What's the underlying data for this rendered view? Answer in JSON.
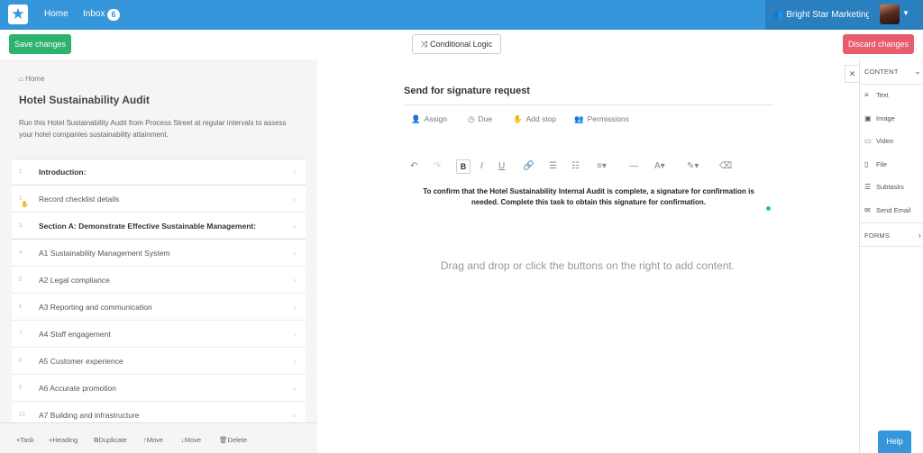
{
  "nav": {
    "home": "Home",
    "inbox": "Inbox",
    "inbox_count": "6",
    "org_name": "Bright Star Marketing"
  },
  "toolbar": {
    "save_label": "Save changes",
    "logic_label": "Conditional Logic",
    "discard_label": "Discard changes"
  },
  "checklist": {
    "breadcrumb": "Home",
    "title": "Hotel Sustainability Audit",
    "description": "Run this Hotel Sustainability Audit from Process Street at regular intervals to assess your hotel companies sustainability attainment.",
    "tasks": [
      {
        "num": "1",
        "label": "Introduction:",
        "heading": true
      },
      {
        "num": "2",
        "label": "Record checklist details",
        "heading": false
      },
      {
        "num": "3",
        "label": "Section A: Demonstrate Effective Sustainable Management:",
        "heading": true
      },
      {
        "num": "4",
        "label": "A1 Sustainability Management System",
        "heading": false
      },
      {
        "num": "5",
        "label": "A2 Legal compliance",
        "heading": false
      },
      {
        "num": "6",
        "label": "A3 Reporting and communication",
        "heading": false
      },
      {
        "num": "7",
        "label": "A4 Staff engagement",
        "heading": false
      },
      {
        "num": "8",
        "label": "A5 Customer experience",
        "heading": false
      },
      {
        "num": "9",
        "label": "A6 Accurate promotion",
        "heading": false
      },
      {
        "num": "10",
        "label": "A7 Building and infrastructure",
        "heading": false
      }
    ]
  },
  "bottom_actions": {
    "task": "Task",
    "heading": "Heading",
    "duplicate": "Duplicate",
    "move_up": "Move",
    "move_down": "Move",
    "delete": "Delete"
  },
  "editor": {
    "task_title": "Send for signature request",
    "assign": "Assign",
    "due": "Due",
    "add_stop": "Add stop",
    "permissions": "Permissions",
    "body": "To confirm that the Hotel Sustainability Internal Audit is complete, a signature for confirmation is needed. Complete this task to obtain this signature for confirmation.",
    "dropzone": "Drag and drop or click the buttons on the right to add content."
  },
  "sidebar": {
    "content_header": "CONTENT",
    "items": [
      "Text",
      "Image",
      "Video",
      "File",
      "Subtasks",
      "Send Email"
    ],
    "forms_header": "FORMS"
  },
  "help_label": "Help",
  "colors": {
    "nav_blue": "#3596dc",
    "save_green": "#2db36c",
    "discard_red": "#e85d6e",
    "teal": "#22c4a1"
  }
}
